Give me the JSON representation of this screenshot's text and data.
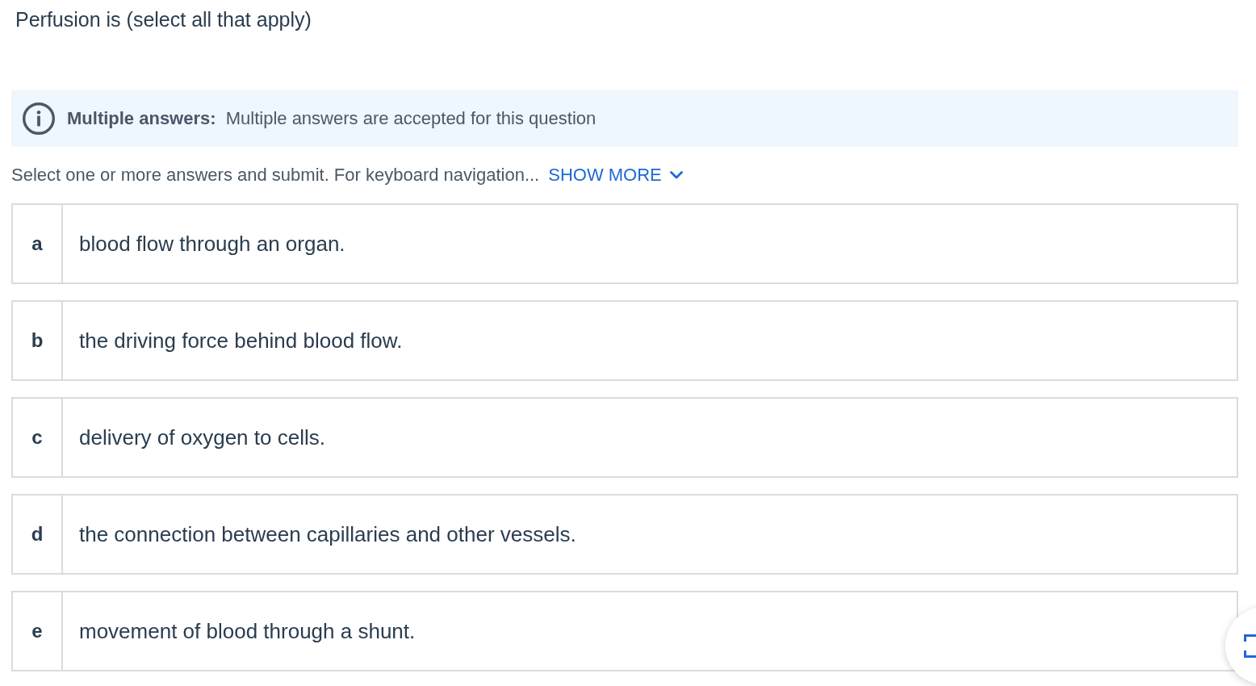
{
  "question": {
    "title": "Perfusion is (select all that apply)"
  },
  "notice": {
    "text": "**Multiple answers:** Multiple answers are accepted for this question"
  },
  "instructions": {
    "text": "Select one or more answers and submit. For keyboard navigation...",
    "link": "SHOW MORE"
  },
  "options": [
    {
      "letter": "a",
      "text": "blood flow through an organ.",
      "selected": false
    },
    {
      "letter": "b",
      "text": "the driving force behind blood flow.",
      "selected": false
    },
    {
      "letter": "c",
      "text": "delivery of oxygen to cells.",
      "selected": false
    },
    {
      "letter": "d",
      "text": "the connection between capillaries and other vessels.",
      "selected": false
    },
    {
      "letter": "e",
      "text": "movement of blood through a shunt.",
      "selected": false
    }
  ]
}
